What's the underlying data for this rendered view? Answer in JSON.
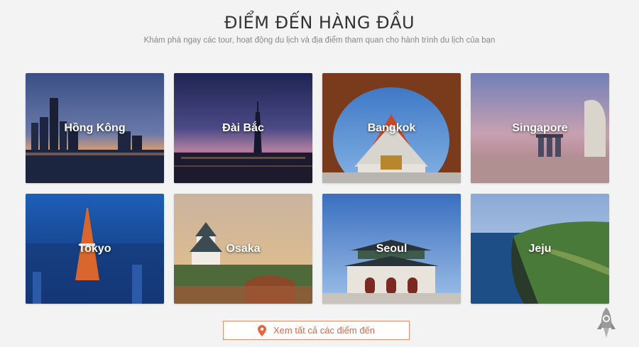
{
  "header": {
    "title": "ĐIỂM ĐẾN HÀNG ĐẦU",
    "subtitle": "Khám phá ngay các tour, hoạt động du lịch và địa điểm tham quan cho hành trình du lịch của bạn"
  },
  "destinations": [
    {
      "name": "Hồng Kông"
    },
    {
      "name": "Đài Bắc"
    },
    {
      "name": "Bangkok"
    },
    {
      "name": "Singapore"
    },
    {
      "name": "Tokyo"
    },
    {
      "name": "Osaka"
    },
    {
      "name": "Seoul"
    },
    {
      "name": "Jeju"
    }
  ],
  "cta": {
    "label": "Xem tất cả các điểm đến",
    "icon": "map-pin-icon"
  },
  "scroll_top": {
    "icon": "rocket-icon"
  },
  "colors": {
    "accent": "#e8633f",
    "background": "#f3f3f3",
    "title": "#333333",
    "subtitle": "#888888"
  }
}
